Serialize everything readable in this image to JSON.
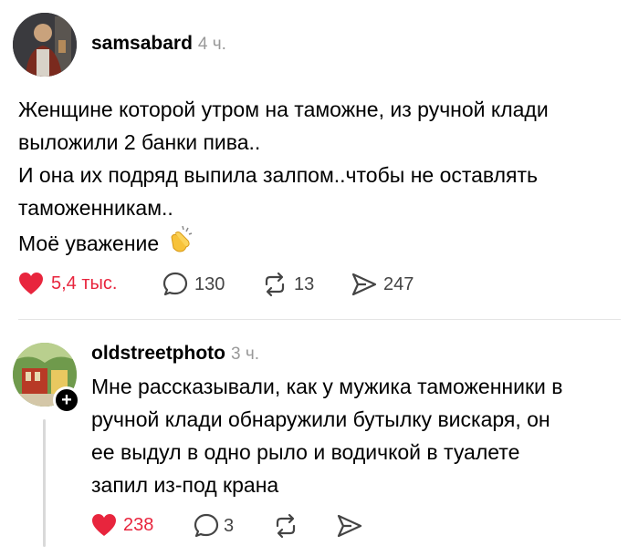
{
  "post": {
    "username": "samsabard",
    "time": "4 ч.",
    "lines": [
      "Женщине которой утром на таможне, из ручной клади",
      "выложили 2 банки пива..",
      "И она их подряд выпила залпом..чтобы не оставлять",
      "таможенникам..",
      "Моё уважение"
    ],
    "emoji": "clapping-hands",
    "actions": {
      "likes": "5,4 тыс.",
      "comments": "130",
      "reposts": "13",
      "shares": "247"
    }
  },
  "reply": {
    "username": "oldstreetphoto",
    "time": "3 ч.",
    "lines": [
      "Мне рассказывали, как у мужика таможенники в",
      "ручной клади обнаружили бутылку вискаря, он",
      "ее выдул в одно рыло и водичкой в туалете",
      "запил из-под крана"
    ],
    "actions": {
      "likes": "238",
      "comments": "3"
    }
  },
  "colors": {
    "like": "#e8253d",
    "muted": "#999999",
    "icon": "#444444"
  }
}
